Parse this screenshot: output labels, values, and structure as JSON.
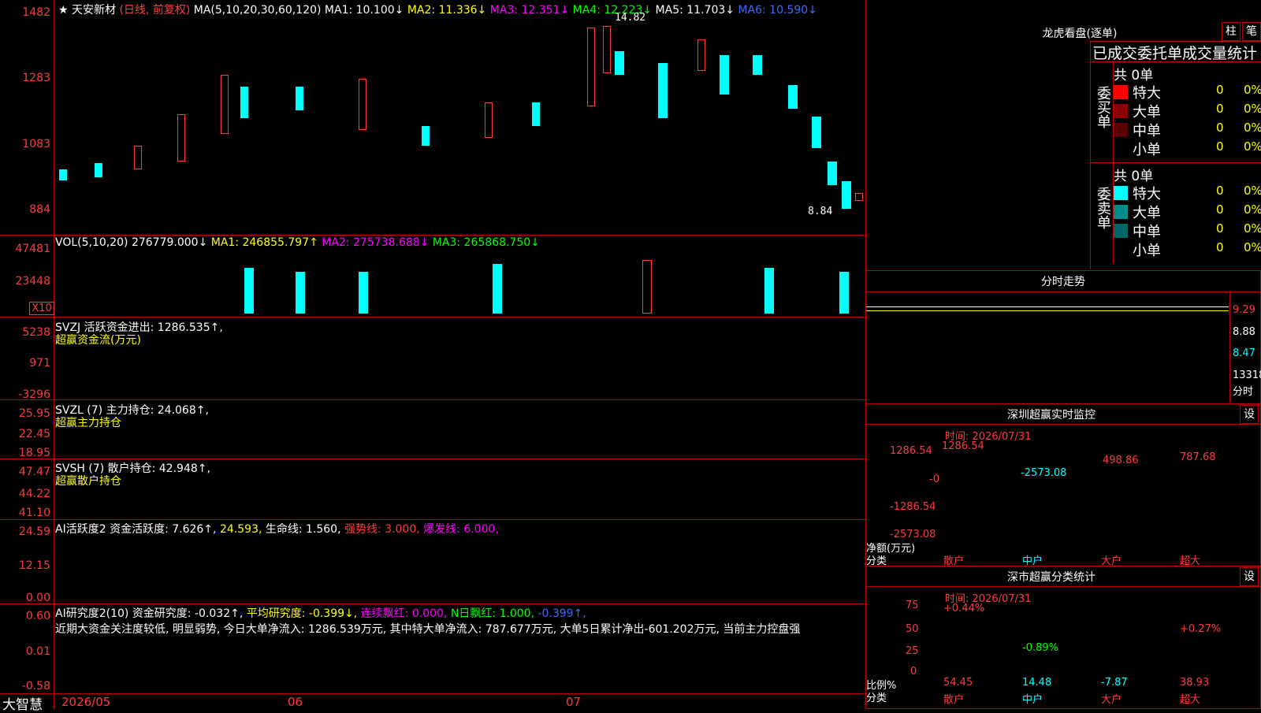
{
  "main_title": {
    "star": "★",
    "stock": "天安新材",
    "mode": "(日线, 前复权)"
  },
  "ma_header": {
    "params": "MA(5,10,20,30,60,120)",
    "ma1": "MA1: 10.100↓",
    "ma2": "MA2: 11.336↓",
    "ma3": "MA3: 12.351↓",
    "ma4": "MA4: 12.223↓",
    "ma5": "MA5: 11.703↓",
    "ma6": "MA6: 10.590↓"
  },
  "price_axis": [
    "1482",
    "1283",
    "1083",
    "884"
  ],
  "price_notes": {
    "high": "14.82",
    "low": "8.84"
  },
  "vol_panel": {
    "title": "VOL(5,10,20) 276779.000↓",
    "ma1": "MA1: 246855.797↑",
    "ma2": "MA2: 275738.688↓",
    "ma3": "MA3: 265868.750↓",
    "axis": [
      "47481",
      "23448"
    ],
    "unit": "X10"
  },
  "svzj_panel": {
    "title": "SVZJ  活跃资金进出: 1286.535↑,",
    "subtitle": "超赢资金流(万元)",
    "axis": [
      "5238",
      "971",
      "-3296"
    ]
  },
  "svzl_panel": {
    "title": "SVZL (7) 主力持仓: 24.068↑,",
    "subtitle": "超赢主力持仓",
    "axis": [
      "25.95",
      "22.45",
      "18.95"
    ]
  },
  "svsh_panel": {
    "title": "SVSH (7) 散户持仓: 42.948↑,",
    "subtitle": "超赢散户持仓",
    "axis": [
      "47.47",
      "44.22",
      "41.10"
    ]
  },
  "ai_active_panel": {
    "title": "AI活跃度2 资金活跃度: 7.626↑,",
    "v2": "24.593,",
    "v3": "生命线: 1.560,",
    "v4": "强势线: 3.000,",
    "v5": "爆发线: 6.000,",
    "axis": [
      "24.59",
      "12.15",
      "0.00"
    ]
  },
  "ai_research_panel": {
    "title": "AI研究度2(10) 资金研究度: -0.032↑,",
    "v2": "平均研究度: -0.399↓,",
    "v3": "连续飘红: 0.000,",
    "v4": "N日飘红: 1.000,",
    "v5": "-0.399↑,",
    "commentary": "近期大资金关注度较低, 明显弱势, 今日大单净流入: 1286.539万元, 其中特大单净流入: 787.677万元, 大单5日累计净出-601.202万元, 当前主力控盘强",
    "axis": [
      "0.60",
      "0.01",
      "-0.58"
    ]
  },
  "bottom_bar": {
    "brand": "大智慧",
    "date": "2026/05",
    "m06": "06",
    "m07": "07"
  },
  "dragon_tiger": {
    "title": "龙虎看盘(逐单)",
    "btn_col": "柱",
    "btn_pen": "笔",
    "subtitle": "已成交委托单成交量统计",
    "buy": {
      "label": "委买单",
      "total": "共 0单",
      "rows": [
        {
          "name": "特大",
          "count": "0",
          "pct": "0%",
          "color": "#ff0000"
        },
        {
          "name": "大单",
          "count": "0",
          "pct": "0%",
          "color": "#8b0000"
        },
        {
          "name": "中单",
          "count": "0",
          "pct": "0%",
          "color": "#5a0000"
        },
        {
          "name": "小单",
          "count": "0",
          "pct": "0%",
          "color": "#000000"
        }
      ]
    },
    "sell": {
      "label": "委卖单",
      "total": "共 0单",
      "rows": [
        {
          "name": "特大",
          "count": "0",
          "pct": "0%",
          "color": "#00ffff"
        },
        {
          "name": "大单",
          "count": "0",
          "pct": "0%",
          "color": "#008b8b"
        },
        {
          "name": "中单",
          "count": "0",
          "pct": "0%",
          "color": "#006666"
        },
        {
          "name": "小单",
          "count": "0",
          "pct": "0%",
          "color": "#000000"
        }
      ]
    }
  },
  "intraday": {
    "title": "分时走势",
    "axis": [
      "9.29",
      "8.88",
      "8.47"
    ],
    "volume": "13318",
    "volume_label": "分时"
  },
  "sz_monitor": {
    "title": "深圳超赢实时监控",
    "btn": "设",
    "time": "时间: 2026/07/31",
    "axis": [
      "1286.54",
      "-0",
      "-1286.54",
      "-2573.08"
    ],
    "ylabel": "净额(万元)",
    "xlabel": "分类",
    "bars": [
      {
        "cat": "散户",
        "value": "1286.54"
      },
      {
        "cat": "中户",
        "value": "-2573.08"
      },
      {
        "cat": "大户",
        "value": "498.86"
      },
      {
        "cat": "超大",
        "value": "787.68"
      }
    ]
  },
  "sz_class": {
    "title": "深市超赢分类统计",
    "btn": "设",
    "time": "时间: 2026/07/31",
    "axis": [
      "75",
      "50",
      "25",
      "0"
    ],
    "ylabel": "比例%",
    "xlabel": "分类",
    "bars": [
      {
        "cat": "散户",
        "pct": "+0.44%",
        "value": "54.45"
      },
      {
        "cat": "中户",
        "pct": "-0.89%",
        "value": "14.48"
      },
      {
        "cat": "大户",
        "pct": "",
        "value": "-7.87"
      },
      {
        "cat": "超大",
        "pct": "+0.27%",
        "value": "38.93"
      }
    ]
  }
}
